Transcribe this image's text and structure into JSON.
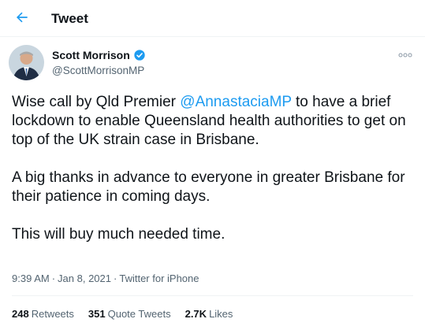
{
  "header": {
    "back_icon": "arrow-left-icon",
    "title": "Tweet"
  },
  "colors": {
    "accent": "#1d9bf0",
    "text": "#0f1419",
    "secondary": "#536471"
  },
  "author": {
    "name": "Scott Morrison",
    "handle": "@ScottMorrisonMP",
    "verified_icon": "verified-badge-icon",
    "avatar_icon": "profile-photo"
  },
  "more_icon": "more-dots-icon",
  "tweet": {
    "p1_before": "Wise call by Qld Premier ",
    "p1_mention": "@AnnastaciaMP",
    "p1_after": " to have a brief lockdown to enable Queensland health authorities to get on top of the UK strain case in Brisbane.",
    "p2": "A big thanks in advance to everyone in greater Brisbane for their patience in coming days.",
    "p3": "This will buy much needed time."
  },
  "meta": {
    "time": "9:39 AM",
    "date": "Jan 8, 2021",
    "source": "Twitter for iPhone",
    "separator": "·"
  },
  "stats": {
    "retweets_count": "248",
    "retweets_label": "Retweets",
    "quotes_count": "351",
    "quotes_label": "Quote Tweets",
    "likes_count": "2.7K",
    "likes_label": "Likes"
  }
}
